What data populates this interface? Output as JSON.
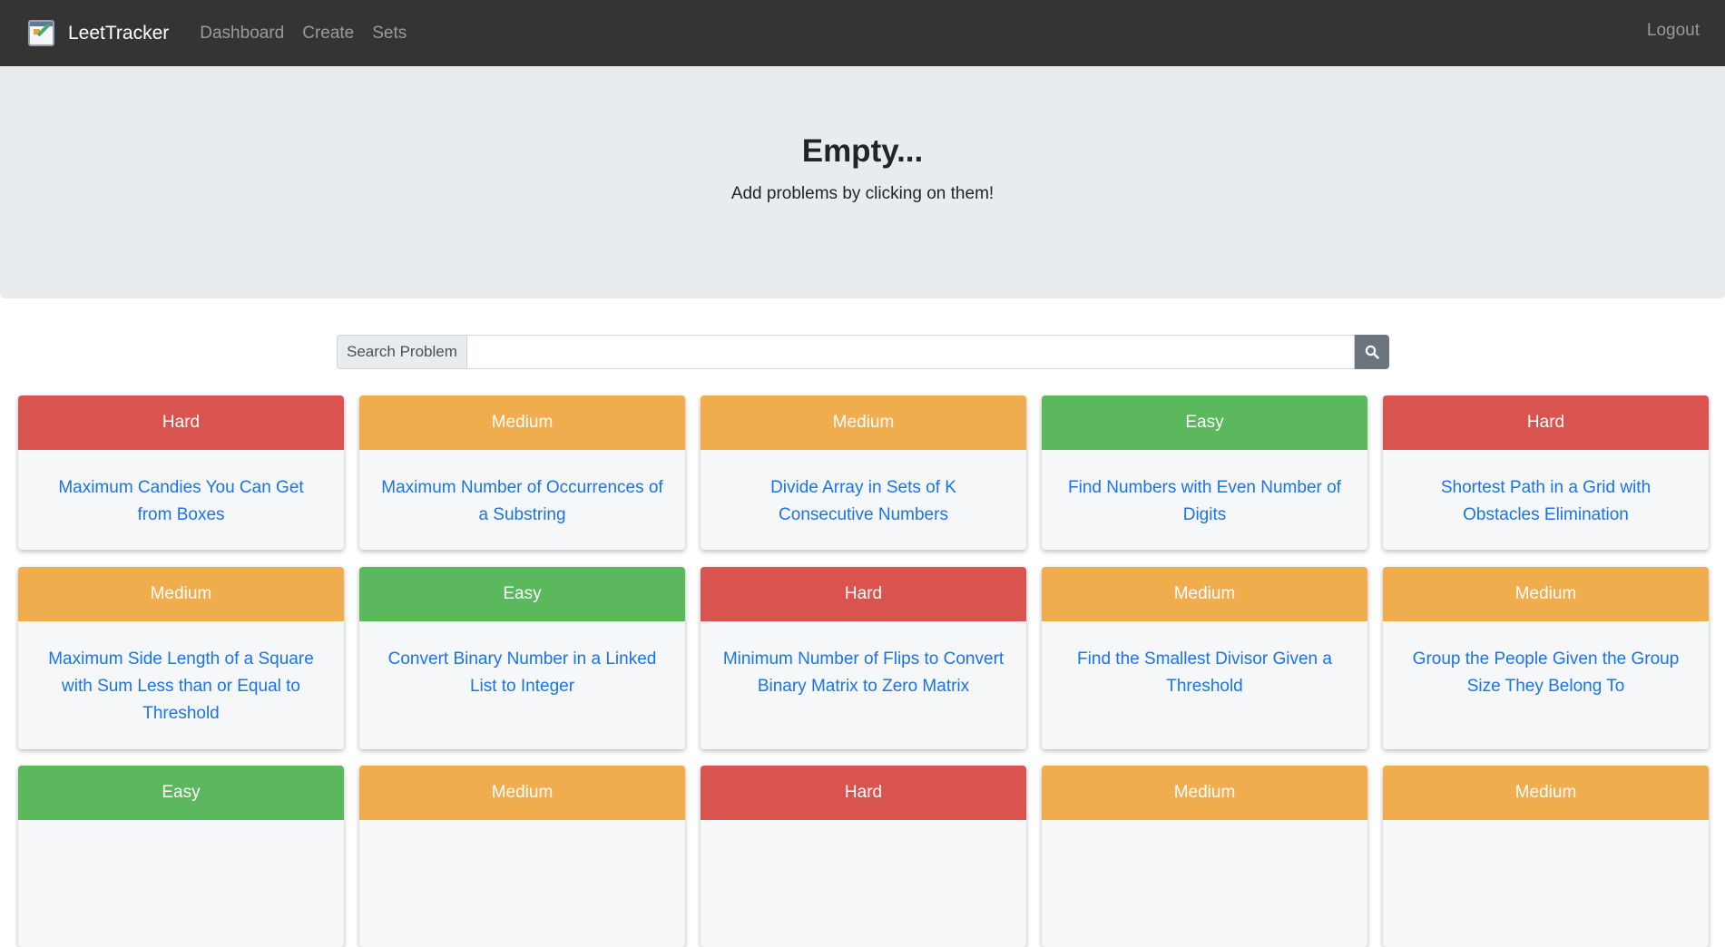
{
  "nav": {
    "brand": "LeetTracker",
    "links": [
      "Dashboard",
      "Create",
      "Sets"
    ],
    "logout": "Logout"
  },
  "jumbotron": {
    "title": "Empty...",
    "subtitle": "Add problems by clicking on them!"
  },
  "search": {
    "label": "Search Problem",
    "value": "",
    "button_icon": "search-icon"
  },
  "difficulty_colors": {
    "Hard": "#d9534f",
    "Medium": "#f0ad4e",
    "Easy": "#5cb85c"
  },
  "problems": [
    {
      "difficulty": "Hard",
      "title": "Maximum Candies You Can Get from Boxes"
    },
    {
      "difficulty": "Medium",
      "title": "Maximum Number of Occurrences of a Substring"
    },
    {
      "difficulty": "Medium",
      "title": "Divide Array in Sets of K Consecutive Numbers"
    },
    {
      "difficulty": "Easy",
      "title": "Find Numbers with Even Number of Digits"
    },
    {
      "difficulty": "Hard",
      "title": "Shortest Path in a Grid with Obstacles Elimination"
    },
    {
      "difficulty": "Medium",
      "title": "Maximum Side Length of a Square with Sum Less than or Equal to Threshold"
    },
    {
      "difficulty": "Easy",
      "title": "Convert Binary Number in a Linked List to Integer"
    },
    {
      "difficulty": "Hard",
      "title": "Minimum Number of Flips to Convert Binary Matrix to Zero Matrix"
    },
    {
      "difficulty": "Medium",
      "title": "Find the Smallest Divisor Given a Threshold"
    },
    {
      "difficulty": "Medium",
      "title": "Group the People Given the Group Size They Belong To"
    },
    {
      "difficulty": "Easy",
      "title": ""
    },
    {
      "difficulty": "Medium",
      "title": ""
    },
    {
      "difficulty": "Hard",
      "title": ""
    },
    {
      "difficulty": "Medium",
      "title": ""
    },
    {
      "difficulty": "Medium",
      "title": ""
    }
  ]
}
